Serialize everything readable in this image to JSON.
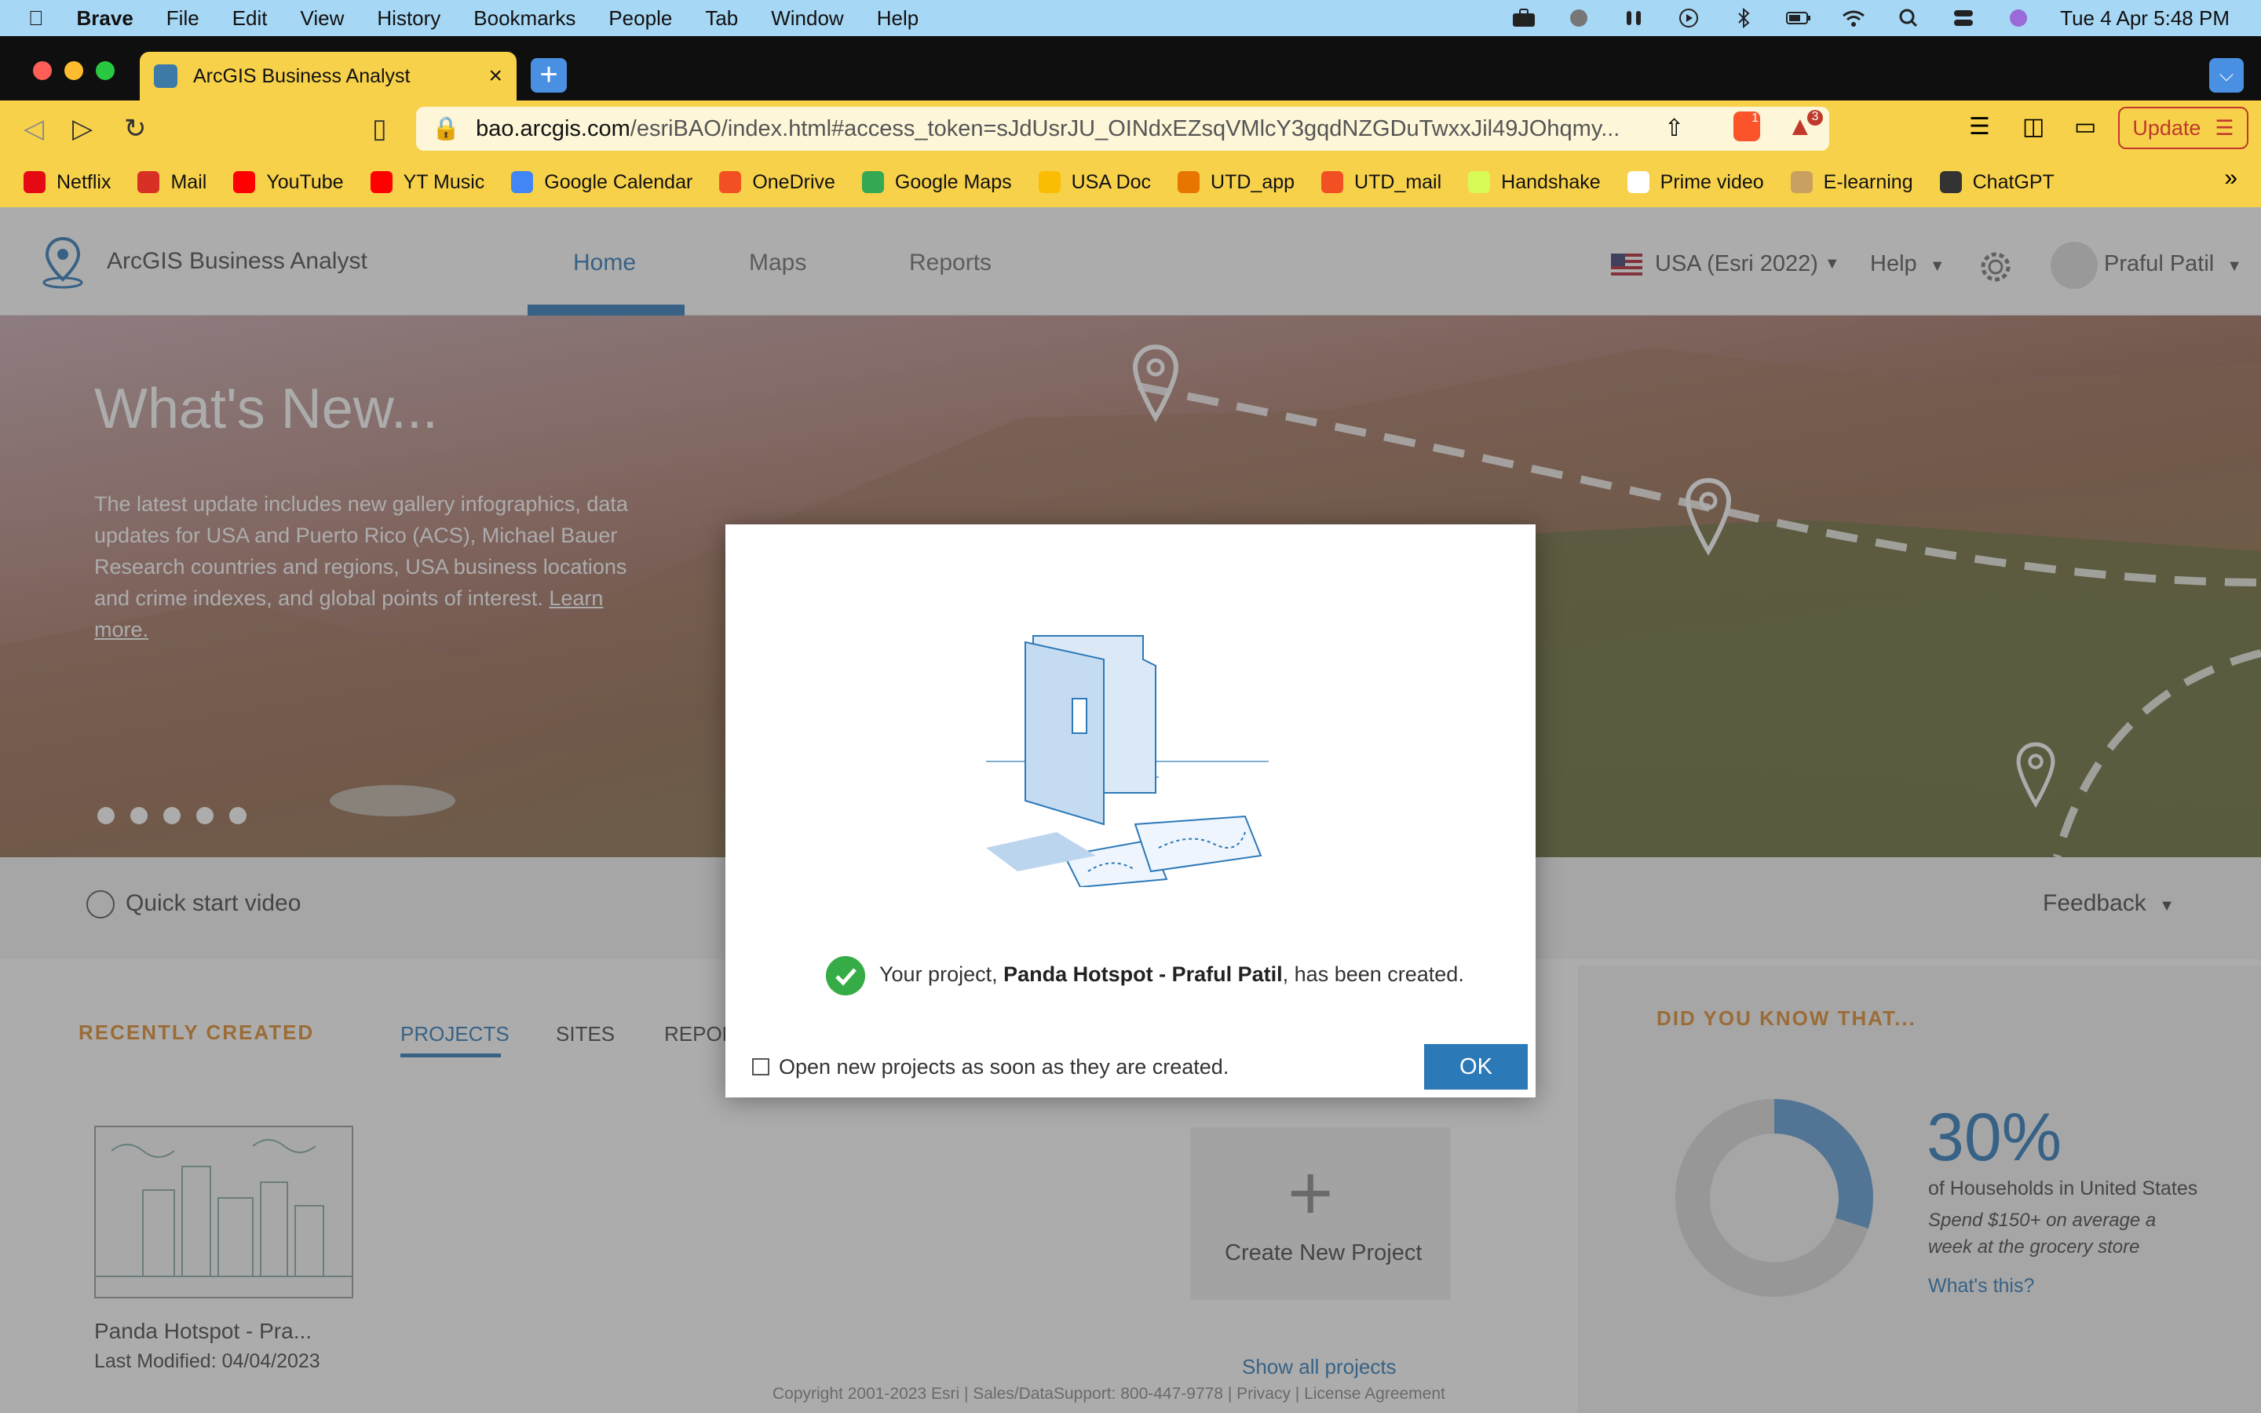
{
  "macos_menu": {
    "brand": "Brave",
    "items": [
      "File",
      "Edit",
      "View",
      "History",
      "Bookmarks",
      "People",
      "Tab",
      "Window",
      "Help"
    ],
    "clock": "Tue 4 Apr  5:48 PM"
  },
  "browser": {
    "tab_title": "ArcGIS Business Analyst",
    "url_host": "bao.arcgis.com",
    "url_path": "/esriBAO/index.html#access_token=sJdUsrJU_OINdxEZsqVMlcY3gqdNZGDuTwxxJil49JOhqmy...",
    "shield_badge": "1",
    "rewards_badge": "3",
    "update_label": "Update"
  },
  "bookmarks": [
    {
      "label": "Netflix",
      "color": "#e50914"
    },
    {
      "label": "Mail",
      "color": "#d93025"
    },
    {
      "label": "YouTube",
      "color": "#ff0000"
    },
    {
      "label": "YT Music",
      "color": "#ff0000"
    },
    {
      "label": "Google Calendar",
      "color": "#4285f4"
    },
    {
      "label": "OneDrive",
      "color": "#f25022"
    },
    {
      "label": "Google Maps",
      "color": "#34a853"
    },
    {
      "label": "USA Doc",
      "color": "#fbbc04"
    },
    {
      "label": "UTD_app",
      "color": "#e87500"
    },
    {
      "label": "UTD_mail",
      "color": "#f25022"
    },
    {
      "label": "Handshake",
      "color": "#d7fa56"
    },
    {
      "label": "Prime video",
      "color": "#ffffff"
    },
    {
      "label": "E-learning",
      "color": "#c8a060"
    },
    {
      "label": "ChatGPT",
      "color": "#333333"
    }
  ],
  "bookmarks_more": "»",
  "app": {
    "name": "ArcGIS Business Analyst",
    "nav": {
      "home": "Home",
      "maps": "Maps",
      "reports": "Reports"
    },
    "region": "USA (Esri 2022)",
    "help": "Help",
    "user": "Praful Patil"
  },
  "hero": {
    "title": "What's New...",
    "text": "The latest update includes new gallery infographics, data updates for USA and Puerto Rico (ACS), Michael Bauer Research countries and regions, USA business locations and crime indexes, and global points of interest.",
    "link": "Learn more."
  },
  "quickstart": {
    "label": "Quick start video",
    "feedback": "Feedback"
  },
  "recent": {
    "label": "RECENTLY CREATED",
    "tabs": [
      "PROJECTS",
      "SITES",
      "REPOR"
    ],
    "project": {
      "name": "Panda Hotspot - Pra...",
      "modified": "Last Modified: 04/04/2023"
    },
    "create_label": "Create New Project",
    "show_all": "Show all projects",
    "footer": "Copyright 2001-2023 Esri | Sales/DataSupport: 800-447-9778 | Privacy | License Agreement"
  },
  "did_you_know": {
    "title": "DID YOU KNOW THAT...",
    "percent": "30%",
    "percent_value": 30,
    "desc": "of Households in United States",
    "sub": "Spend $150+ on average a week at the grocery store",
    "link": "What's this?"
  },
  "modal": {
    "msg_prefix": "Your project, ",
    "project_name": "Panda Hotspot - Praful Patil",
    "msg_suffix": ", has been created.",
    "checkbox_label": "Open new projects as soon as they are created.",
    "ok": "OK"
  }
}
